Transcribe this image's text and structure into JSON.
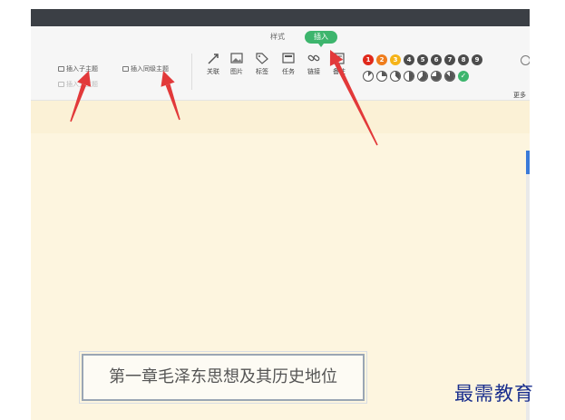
{
  "tabs": {
    "style": "样式",
    "insert": "插入"
  },
  "ribbon": {
    "insert_child": "插入子主题",
    "insert_sibling": "插入同级主题",
    "insert_parent": "插入父主题",
    "tools": [
      {
        "label": "关联",
        "icon": "relation-icon"
      },
      {
        "label": "图片",
        "icon": "image-icon"
      },
      {
        "label": "标签",
        "icon": "tag-icon"
      },
      {
        "label": "任务",
        "icon": "task-icon"
      },
      {
        "label": "链接",
        "icon": "link-icon"
      },
      {
        "label": "备注",
        "icon": "note-icon"
      }
    ],
    "priorities": [
      "1",
      "2",
      "3",
      "4",
      "5",
      "6",
      "7",
      "8",
      "9"
    ],
    "priority_colors": [
      "#e0291b",
      "#ef7d1d",
      "#f5b318",
      "#4c4c4c",
      "#4c4c4c",
      "#4c4c4c",
      "#4c4c4c",
      "#4c4c4c",
      "#4c4c4c"
    ],
    "progress_levels": [
      0.125,
      0.25,
      0.375,
      0.5,
      0.625,
      0.75,
      0.875,
      1.0
    ],
    "more_label": "更多"
  },
  "accent_green": "#3db56d",
  "arrow_color": "#e2393a",
  "topic": {
    "text": "第一章毛泽东思想及其历史地位"
  },
  "watermark": "最需教育"
}
